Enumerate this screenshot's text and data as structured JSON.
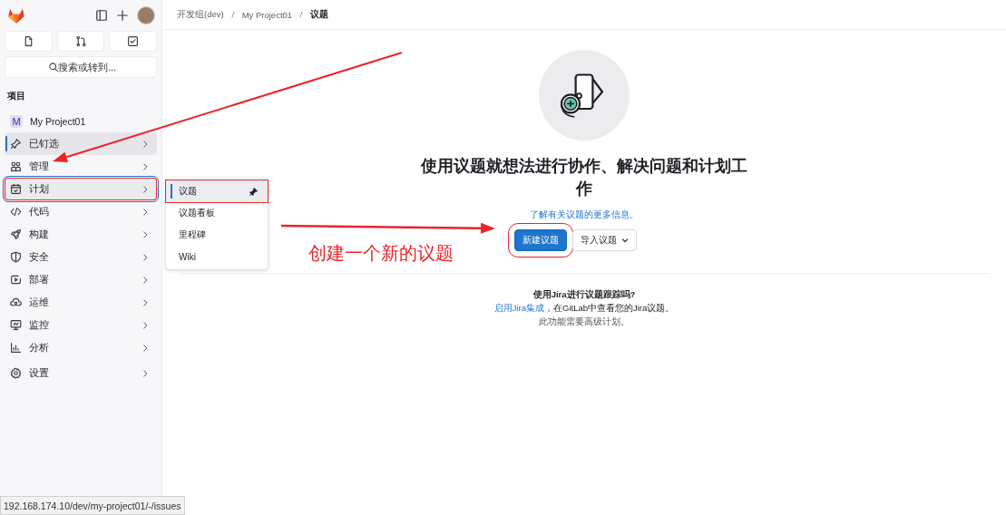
{
  "breadcrumb": [
    "开发组(dev)",
    "My Project01",
    "议题"
  ],
  "sidebar": {
    "search": {
      "placeholder": "搜索或转到..."
    },
    "section_title": "项目",
    "project": {
      "avatar": "M",
      "name": "My Project01"
    },
    "items": [
      {
        "label": "已钉选",
        "selected": true,
        "hovered": false,
        "focused": false,
        "annotated": false
      },
      {
        "label": "管理",
        "selected": false,
        "hovered": false,
        "focused": false,
        "annotated": false
      },
      {
        "label": "计划",
        "selected": false,
        "hovered": true,
        "focused": true,
        "annotated": true
      },
      {
        "label": "代码",
        "selected": false,
        "hovered": false,
        "focused": false,
        "annotated": false
      },
      {
        "label": "构建",
        "selected": false,
        "hovered": false,
        "focused": false,
        "annotated": false
      },
      {
        "label": "安全",
        "selected": false,
        "hovered": false,
        "focused": false,
        "annotated": false
      },
      {
        "label": "部署",
        "selected": false,
        "hovered": false,
        "focused": false,
        "annotated": false
      },
      {
        "label": "运维",
        "selected": false,
        "hovered": false,
        "focused": false,
        "annotated": false
      },
      {
        "label": "监控",
        "selected": false,
        "hovered": false,
        "focused": false,
        "annotated": false
      },
      {
        "label": "分析",
        "selected": false,
        "hovered": false,
        "focused": false,
        "annotated": false
      },
      {
        "label": "设置",
        "selected": false,
        "hovered": false,
        "focused": false,
        "annotated": false
      }
    ]
  },
  "flyout": {
    "items": [
      {
        "label": "议题",
        "selected": true,
        "pinned": true,
        "annotated": true
      },
      {
        "label": "议题看板",
        "selected": false,
        "pinned": false,
        "annotated": false
      },
      {
        "label": "里程碑",
        "selected": false,
        "pinned": false,
        "annotated": false
      },
      {
        "label": "Wiki",
        "selected": false,
        "pinned": false,
        "annotated": false
      }
    ]
  },
  "empty_state": {
    "title": "使用议题就想法进行协作、解决问题和计划工作",
    "link": "了解有关议题的更多信息。",
    "buttons": [
      {
        "label": "新建议题",
        "kind": "primary",
        "annotated": true
      },
      {
        "label": "导入议题",
        "kind": "dropdown",
        "annotated": false
      }
    ]
  },
  "jira": {
    "title": "使用Jira进行议题跟踪吗?",
    "link": "启用Jira集成",
    "text": "，在GitLab中查看您的Jira议题。",
    "note": "此功能需要高级计划。"
  },
  "annotations": [
    {
      "kind": "arrow"
    },
    {
      "kind": "arrow"
    },
    {
      "kind": "note",
      "text": "创建一个新的议题"
    }
  ],
  "status_url": "192.168.174.10/dev/my-project01/-/issues"
}
